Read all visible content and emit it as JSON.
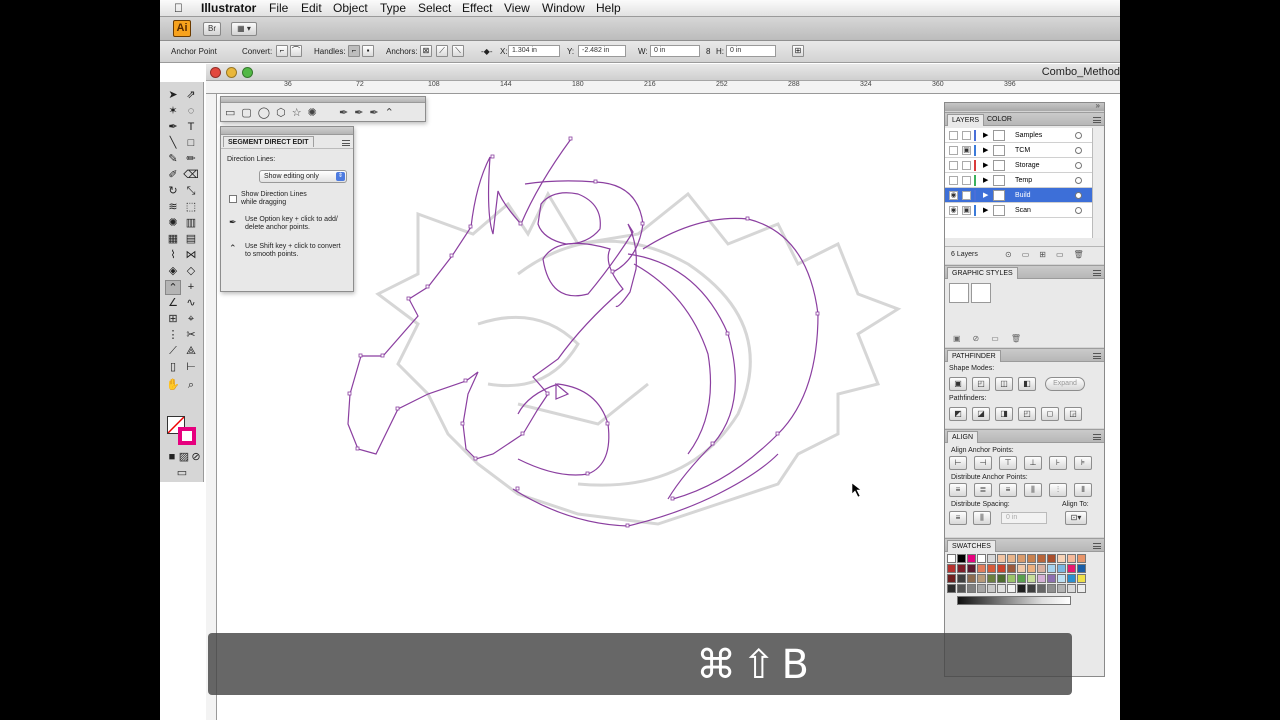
{
  "menubar": {
    "apple": "",
    "app_name": "Illustrator",
    "items": [
      "File",
      "Edit",
      "Object",
      "Type",
      "Select",
      "Effect",
      "View",
      "Window",
      "Help"
    ]
  },
  "appbar": {
    "logo": "Ai",
    "bridge_label": "Br"
  },
  "control_bar": {
    "tool_name": "Anchor Point",
    "convert_label": "Convert:",
    "handles_label": "Handles:",
    "anchors_label": "Anchors:",
    "x_label": "X:",
    "x_value": "1.304 in",
    "y_label": "Y:",
    "y_value": "-2.482 in",
    "w_label": "W:",
    "w_value": "0 in",
    "h_label": "H:",
    "h_value": "0 in"
  },
  "document": {
    "title": "Combo_Method",
    "ruler_marks": [
      "36",
      "72",
      "108",
      "144",
      "180",
      "216",
      "252",
      "288",
      "324",
      "360",
      "396"
    ]
  },
  "segment_panel": {
    "title": "SEGMENT DIRECT EDIT",
    "direction_lines_label": "Direction Lines:",
    "dropdown_value": "Show editing only",
    "checkbox_label_1": "Show Direction Lines",
    "checkbox_label_2": "while dragging",
    "tip1_line1": "Use Option key + click to add/",
    "tip1_line2": "delete anchor points.",
    "tip2_line1": "Use Shift key + click to convert",
    "tip2_line2": "to smooth points."
  },
  "layers_panel": {
    "tab_layers": "LAYERS",
    "tab_color": "COLOR",
    "layers": [
      {
        "name": "Samples",
        "visible": false,
        "locked": false,
        "color": "#4a6fd8"
      },
      {
        "name": "TCM",
        "visible": false,
        "locked": true,
        "color": "#3b7bd9"
      },
      {
        "name": "Storage",
        "visible": false,
        "locked": false,
        "color": "#d93b3b"
      },
      {
        "name": "Temp",
        "visible": false,
        "locked": false,
        "color": "#3bb05c"
      },
      {
        "name": "Build",
        "visible": true,
        "locked": false,
        "color": "#4a6fd8"
      },
      {
        "name": "Scan",
        "visible": true,
        "locked": true,
        "color": "#3b7bd9"
      }
    ],
    "count": "6 Layers"
  },
  "graphic_styles": {
    "title": "GRAPHIC STYLES"
  },
  "pathfinder": {
    "title": "PATHFINDER",
    "shape_modes_label": "Shape Modes:",
    "expand_label": "Expand",
    "pathfinders_label": "Pathfinders:"
  },
  "align": {
    "title": "ALIGN",
    "align_anchor_label": "Align Anchor Points:",
    "distribute_anchor_label": "Distribute Anchor Points:",
    "distribute_spacing_label": "Distribute Spacing:",
    "spacing_value": "0 in",
    "align_to_label": "Align To:"
  },
  "swatches": {
    "title": "SWATCHES",
    "colors": [
      "#ffffff",
      "#000000",
      "#e6007e",
      "#ffffff",
      "#d9d9d9",
      "#f2c5a4",
      "#e8b48a",
      "#d99b6c",
      "#c8814f",
      "#b8653a",
      "#a94f2d",
      "#f7d3b7",
      "#f5b99a",
      "#e8956a",
      "#b5322f",
      "#7d1f2a",
      "#5c1a2f",
      "#e27d5c",
      "#d65b3a",
      "#c9432d",
      "#9c5a3c",
      "#f0c8a8",
      "#ecb07f",
      "#d8b0a0",
      "#a6d3ee",
      "#7bb7e3",
      "#e8196e",
      "#1a5fa8",
      "#6e1f1f",
      "#3f3f3f",
      "#8c6b4f",
      "#b89b7a",
      "#6c7f3f",
      "#4d6b2f",
      "#9bc46a",
      "#5aa04e",
      "#c8de9a",
      "#d5b0d6",
      "#8d6fb0",
      "#bfe1f4",
      "#2a8fd0",
      "#f0e14a",
      "#2c2c2c",
      "#545454",
      "#7f7f7f",
      "#a5a5a5",
      "#c9c9c9",
      "#e0e0e0",
      "#f2f2f2",
      "#1f1f1f",
      "#3d3d3d",
      "#666666",
      "#8f8f8f",
      "#b3b3b3",
      "#d9d9d9",
      "#ededed"
    ]
  },
  "overlay": {
    "shortcut": "⌘⇧B"
  },
  "colors": {
    "path": "#8b3fa0",
    "sketch": "#cfcfcf",
    "selection": "#3d6fd8",
    "fill_swatch": "#e6007e"
  }
}
